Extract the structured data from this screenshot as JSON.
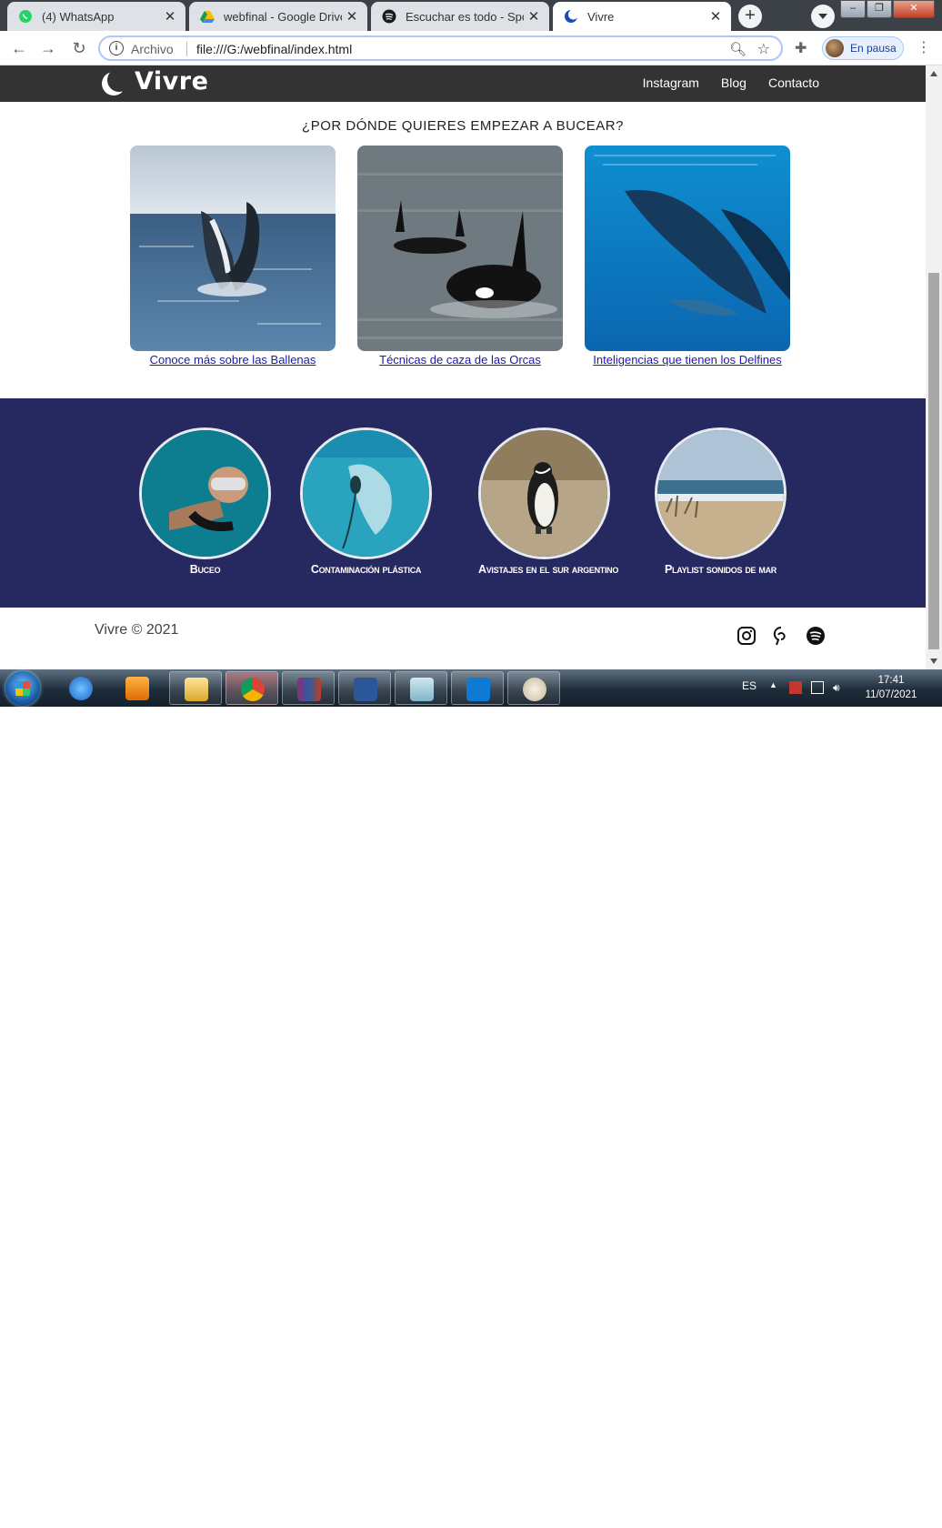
{
  "browser": {
    "tabs": [
      {
        "title": "(4) WhatsApp",
        "favicon": "whatsapp-icon",
        "active": false
      },
      {
        "title": "webfinal - Google Drive",
        "favicon": "google-drive-icon",
        "active": false
      },
      {
        "title": "Escuchar es todo - Spotify",
        "favicon": "spotify-icon",
        "active": false
      },
      {
        "title": "Vivre",
        "favicon": "vivre-moon-icon",
        "active": true
      }
    ],
    "address": {
      "scheme_label": "Archivo",
      "url": "file:///G:/webfinal/index.html"
    },
    "profile_label": "En pausa"
  },
  "site": {
    "brand": "Vivre",
    "nav": [
      "Instagram",
      "Blog",
      "Contacto"
    ],
    "section_title": "¿POR DÓNDE QUIERES EMPEZAR A BUCEAR?",
    "cards": [
      {
        "link": "Conoce más sobre las Ballenas",
        "image": "humpback-whale-breaching"
      },
      {
        "link": "Técnicas de caza de las Orcas",
        "image": "orcas-swimming"
      },
      {
        "link": "Inteligencias que tienen los Delfines",
        "image": "dolphins-underwater"
      }
    ],
    "circles": [
      {
        "label": "Buceo",
        "image": "snorkeler-underwater"
      },
      {
        "label": "Contaminación plástica",
        "image": "plastic-bag-in-sea"
      },
      {
        "label": "Avistajes en el sur argentino",
        "image": "magellanic-penguin"
      },
      {
        "label": "Playlist sonidos de mar",
        "image": "beach-dunes"
      }
    ],
    "footer": {
      "copyright": "Vivre © 2021",
      "social": [
        "instagram-icon",
        "pinterest-icon",
        "spotify-icon"
      ]
    }
  },
  "taskbar": {
    "language": "ES",
    "time": "17:41",
    "date": "11/07/2021"
  },
  "colors": {
    "header": "#333333",
    "band": "#262860",
    "link": "#1a1aa6"
  }
}
